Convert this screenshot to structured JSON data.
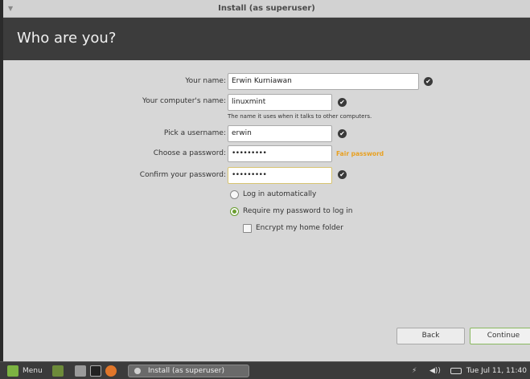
{
  "window": {
    "title": "Install (as superuser)"
  },
  "header": {
    "title": "Who are you?"
  },
  "form": {
    "name_label": "Your name:",
    "name_value": "Erwin Kurniawan",
    "computer_label": "Your computer's name:",
    "computer_value": "linuxmint",
    "computer_hint": "The name it uses when it talks to other computers.",
    "username_label": "Pick a username:",
    "username_value": "erwin",
    "password_label": "Choose a password:",
    "password_value": "•••••••••",
    "password_strength": "Fair password",
    "confirm_label": "Confirm your password:",
    "confirm_value": "•••••••••",
    "login_auto": "Log in automatically",
    "login_password": "Require my password to log in",
    "encrypt_home": "Encrypt my home folder"
  },
  "buttons": {
    "back": "Back",
    "continue": "Continue"
  },
  "taskbar": {
    "menu_label": "Menu",
    "task_label": "Install (as superuser)",
    "clock": "Tue Jul 11, 11:40"
  },
  "colors": {
    "accent_green": "#6a9e30",
    "fair_password": "#e8a020",
    "header_bg": "#3c3c3c"
  }
}
